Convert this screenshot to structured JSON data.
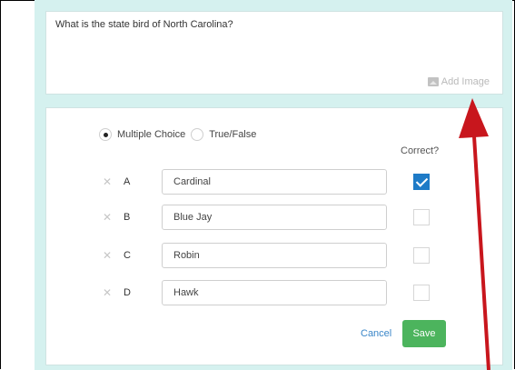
{
  "question": {
    "text": "What is the state bird of North Carolina?",
    "add_image_label": "Add Image"
  },
  "question_type": {
    "options": [
      {
        "label": "Multiple Choice",
        "selected": true
      },
      {
        "label": "True/False",
        "selected": false
      }
    ]
  },
  "answers": {
    "correct_header": "Correct?",
    "rows": [
      {
        "letter": "A",
        "value": "Cardinal",
        "correct": true
      },
      {
        "letter": "B",
        "value": "Blue Jay",
        "correct": false
      },
      {
        "letter": "C",
        "value": "Robin",
        "correct": false
      },
      {
        "letter": "D",
        "value": "Hawk",
        "correct": false
      }
    ]
  },
  "actions": {
    "cancel_label": "Cancel",
    "save_label": "Save"
  },
  "icons": {
    "remove": "close-icon",
    "add_image": "image-icon"
  },
  "colors": {
    "background": "#d5f1ef",
    "save_button": "#4cb45d",
    "checkbox_checked": "#1e7bc7",
    "cancel_link": "#3a86c8",
    "annotation_arrow": "#c8161d"
  }
}
